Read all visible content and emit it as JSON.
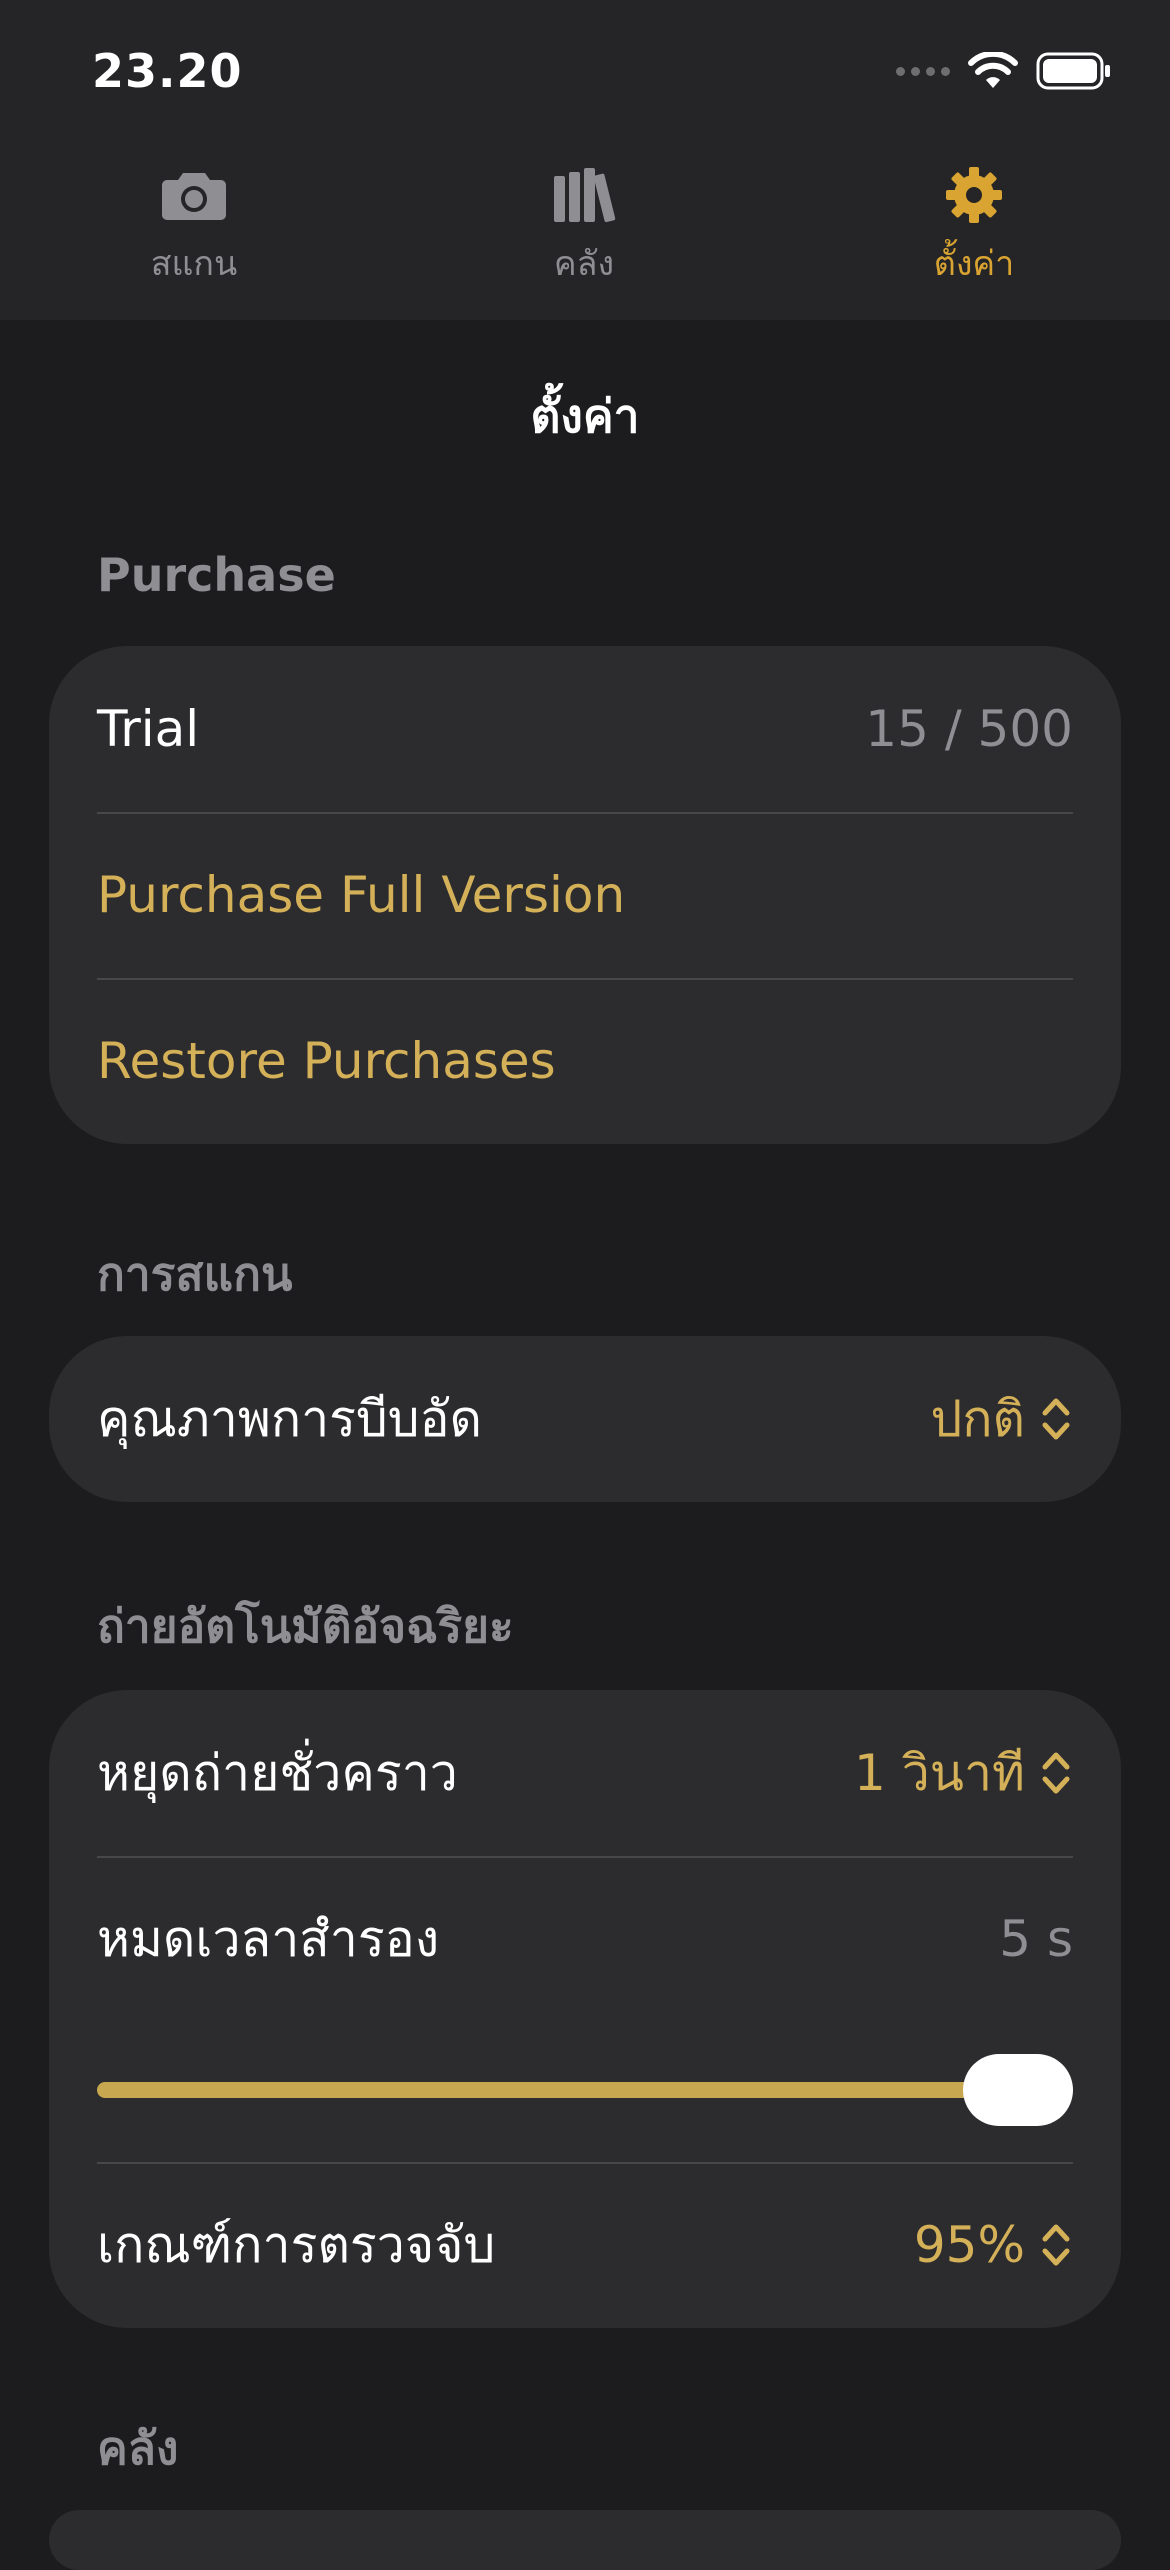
{
  "status_bar": {
    "time": "23.20"
  },
  "tabs": [
    {
      "label": "สแกน",
      "icon": "camera-icon",
      "active": false
    },
    {
      "label": "คลัง",
      "icon": "books-icon",
      "active": false
    },
    {
      "label": "ตั้งค่า",
      "icon": "gear-icon",
      "active": true
    }
  ],
  "page": {
    "title": "ตั้งค่า"
  },
  "sections": {
    "purchase": {
      "header": "Purchase",
      "trial_label": "Trial",
      "trial_value": "15 / 500",
      "purchase_full_label": "Purchase Full Version",
      "restore_label": "Restore Purchases"
    },
    "scanning": {
      "header": "การสแกน",
      "compression_label": "คุณภาพการบีบอัด",
      "compression_value": "ปกติ"
    },
    "smart_capture": {
      "header": "ถ่ายอัตโนมัติอัจฉริยะ",
      "pause_label": "หยุดถ่ายชั่วคราว",
      "pause_value": "1 วินาที",
      "timeout_label": "หมดเวลาสำรอง",
      "timeout_value": "5 s",
      "timeout_slider_fraction": 1.0,
      "threshold_label": "เกณฑ์การตรวจจับ",
      "threshold_value": "95%"
    },
    "library": {
      "header": "คลัง"
    }
  },
  "colors": {
    "accent": "#d4b058",
    "tab_active": "#d9a431",
    "background": "#1c1c1e",
    "card": "#2c2c2e",
    "secondary_text": "#8e8e93"
  }
}
